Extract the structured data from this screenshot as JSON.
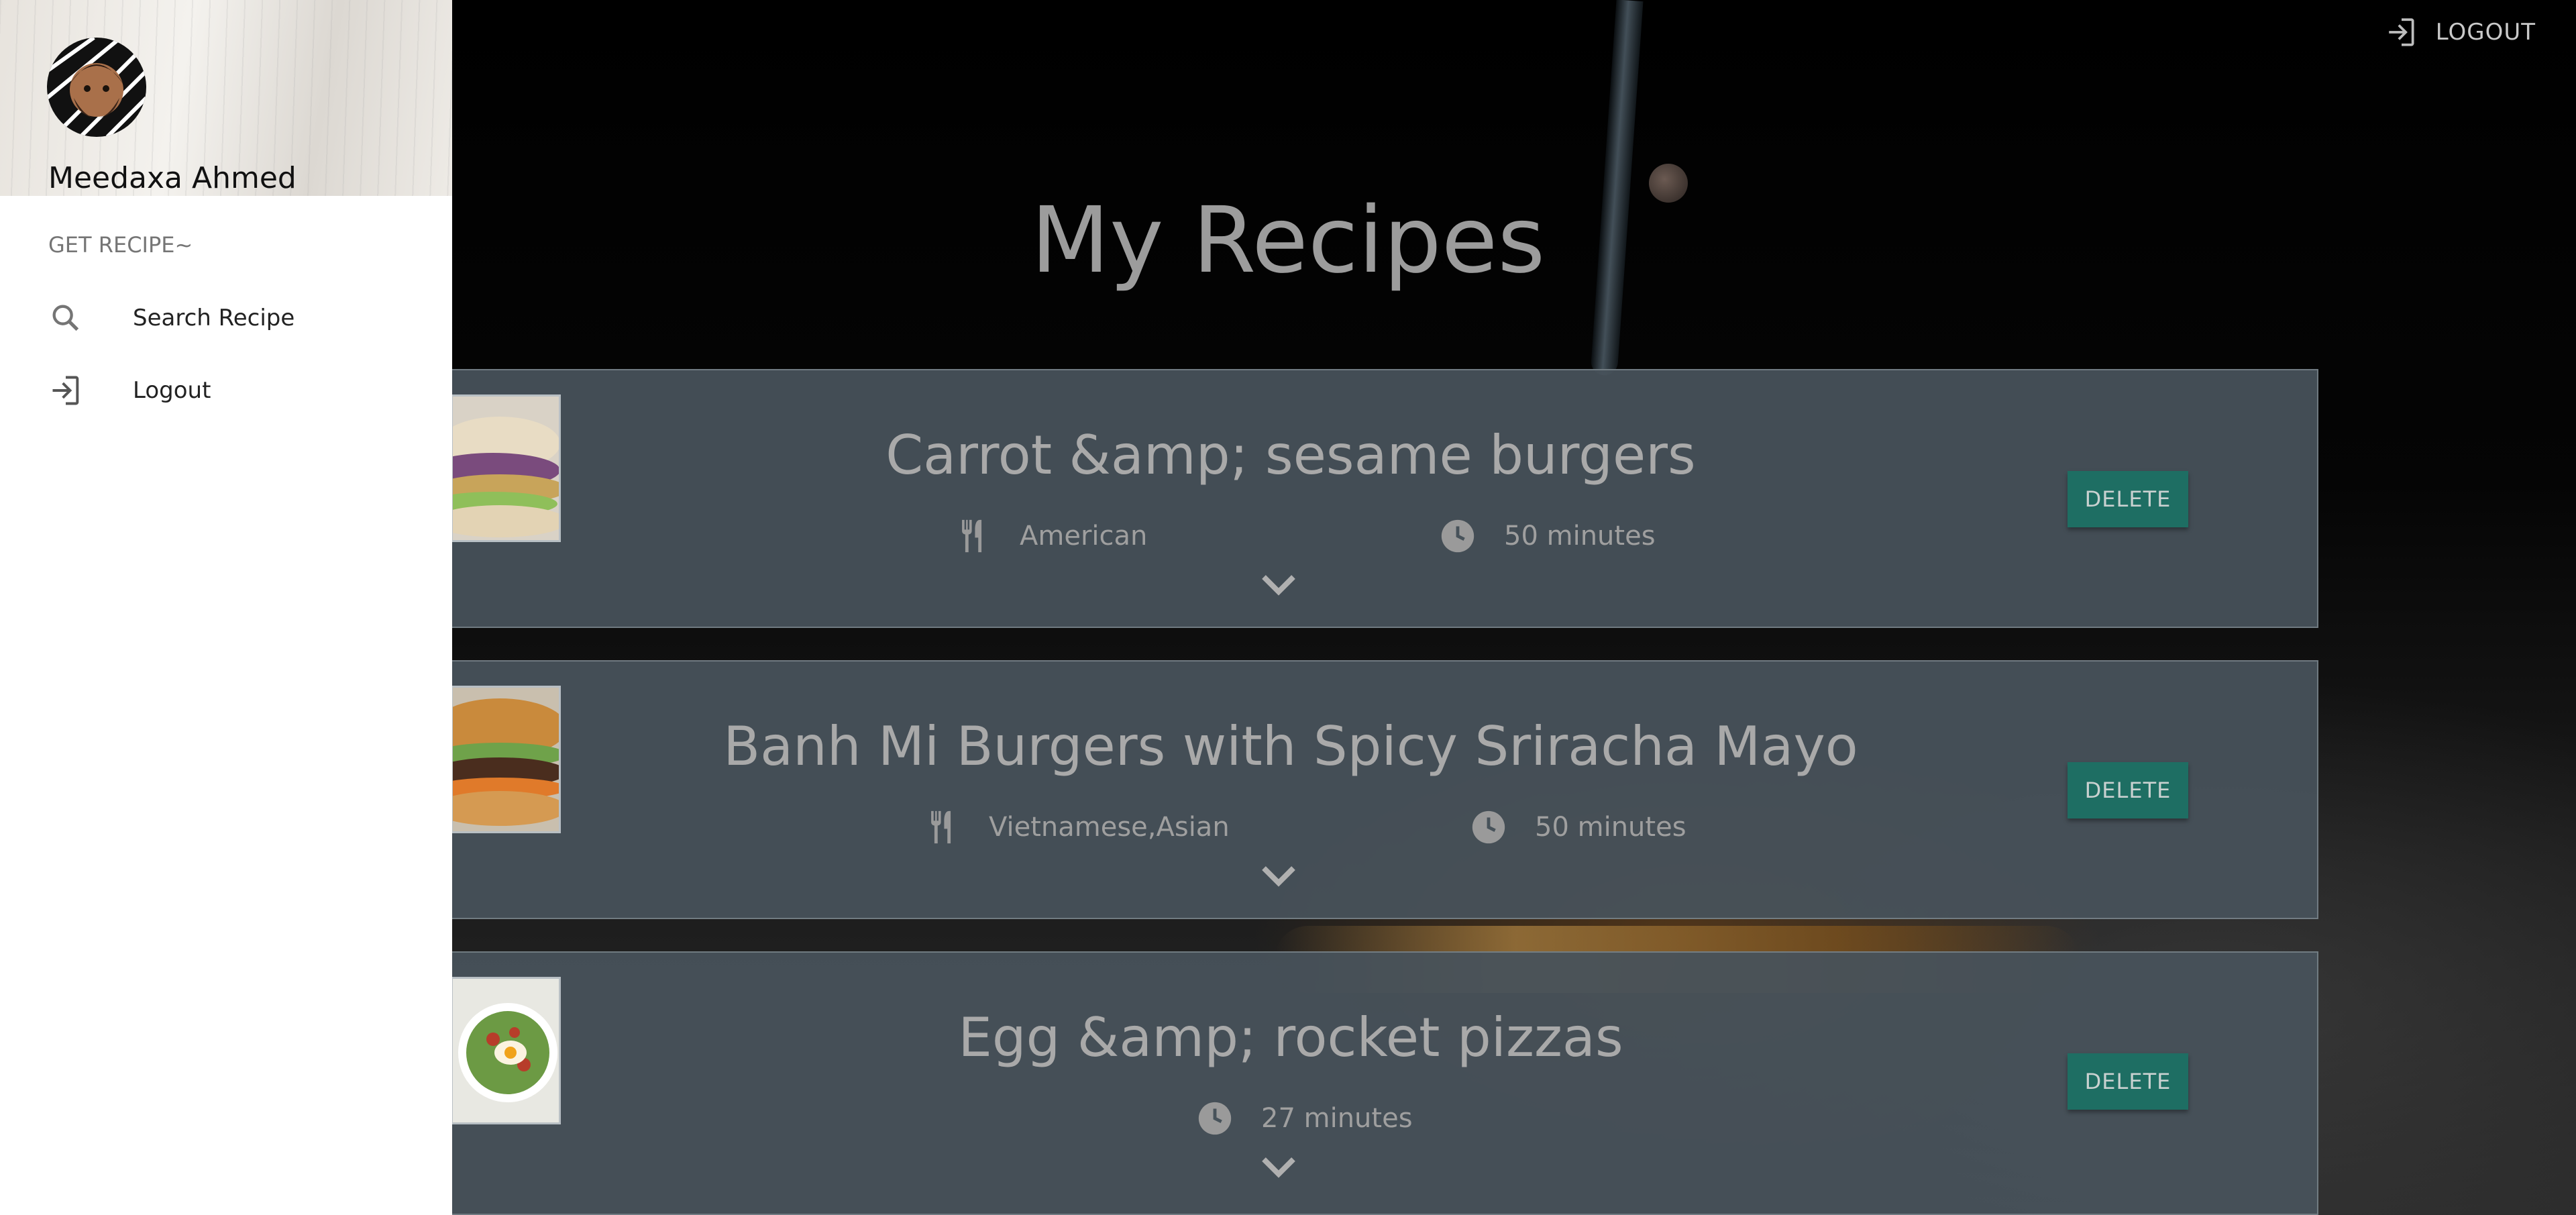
{
  "app": {
    "top_logout_label": "LOGOUT",
    "page_title": "My Recipes"
  },
  "sidebar": {
    "user_name": "Meedaxa Ahmed",
    "section_label": "GET RECIPE~",
    "items": [
      {
        "label": "Search Recipe",
        "icon": "search-icon"
      },
      {
        "label": "Logout",
        "icon": "logout-icon"
      }
    ]
  },
  "recipes": [
    {
      "title": "Carrot &amp; sesame burgers",
      "cuisine": "American",
      "time": "50 minutes",
      "delete_label": "DELETE"
    },
    {
      "title": "Banh Mi Burgers with Spicy Sriracha Mayo",
      "cuisine": "Vietnamese,Asian",
      "time": "50 minutes",
      "delete_label": "DELETE"
    },
    {
      "title": "Egg &amp; rocket pizzas",
      "cuisine": "",
      "time": "27 minutes",
      "delete_label": "DELETE"
    }
  ],
  "colors": {
    "delete_button": "#1e6e63",
    "card_background": "#47525a",
    "sidebar_background": "#ffffff"
  }
}
